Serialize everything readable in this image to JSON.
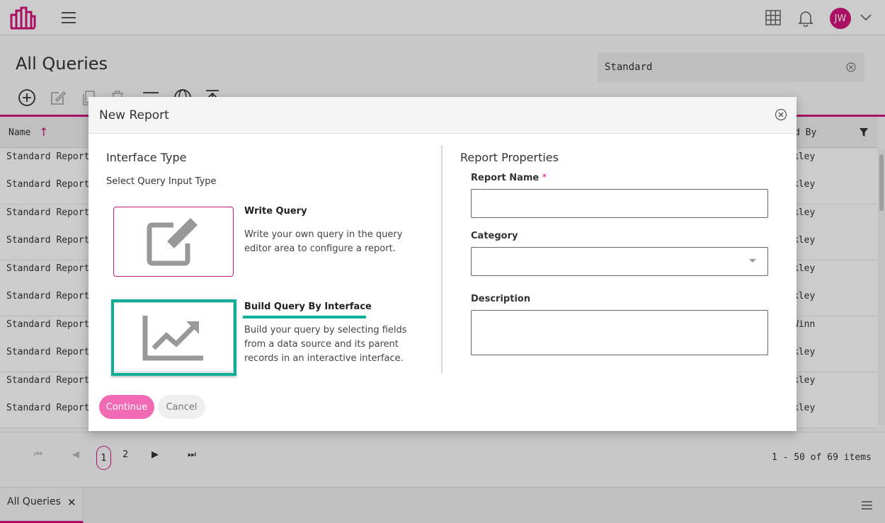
{
  "app": {
    "avatar_initials": "JW",
    "brand_color": "#d4147e"
  },
  "page": {
    "title": "All Queries",
    "search_value": "Standard"
  },
  "grid": {
    "columns": [
      "Name",
      "d By"
    ],
    "rows": [
      {
        "name": "Standard Report -",
        "by": "kley"
      },
      {
        "name": "Standard Report -",
        "by": "kley"
      },
      {
        "name": "Standard Report -",
        "by": "kley"
      },
      {
        "name": "Standard Report -",
        "by": "kley"
      },
      {
        "name": "Standard Report -",
        "by": "kley"
      },
      {
        "name": "Standard Report -",
        "by": "kley"
      },
      {
        "name": "Standard Report -",
        "by": "Winn"
      },
      {
        "name": "Standard Report -",
        "by": "kley"
      },
      {
        "name": "Standard Report -",
        "by": "kley"
      },
      {
        "name": "Standard Report -",
        "by": "kley"
      }
    ]
  },
  "pager": {
    "current_page": "1",
    "next_page": "2",
    "summary": "1 - 50 of 69 items"
  },
  "bottom_tabs": [
    {
      "label": "All Queries"
    }
  ],
  "modal": {
    "title": "New Report",
    "interface_type_title": "Interface Type",
    "select_prompt": "Select Query Input Type",
    "options": [
      {
        "title": "Write Query",
        "description": "Write your own query in the query editor area to configure a report.",
        "icon": "edit-icon"
      },
      {
        "title": "Build Query By Interface",
        "description": "Build your query by selecting fields from a data source and its parent records in an interactive interface.",
        "icon": "chart-trend-icon"
      }
    ],
    "properties_title": "Report Properties",
    "fields": {
      "report_name_label": "Report Name",
      "required_marker": "*",
      "category_label": "Category",
      "description_label": "Description"
    },
    "continue_label": "Continue",
    "cancel_label": "Cancel"
  },
  "colors": {
    "highlight": "#0fae9a",
    "continue_bg": "#f06ab4"
  }
}
